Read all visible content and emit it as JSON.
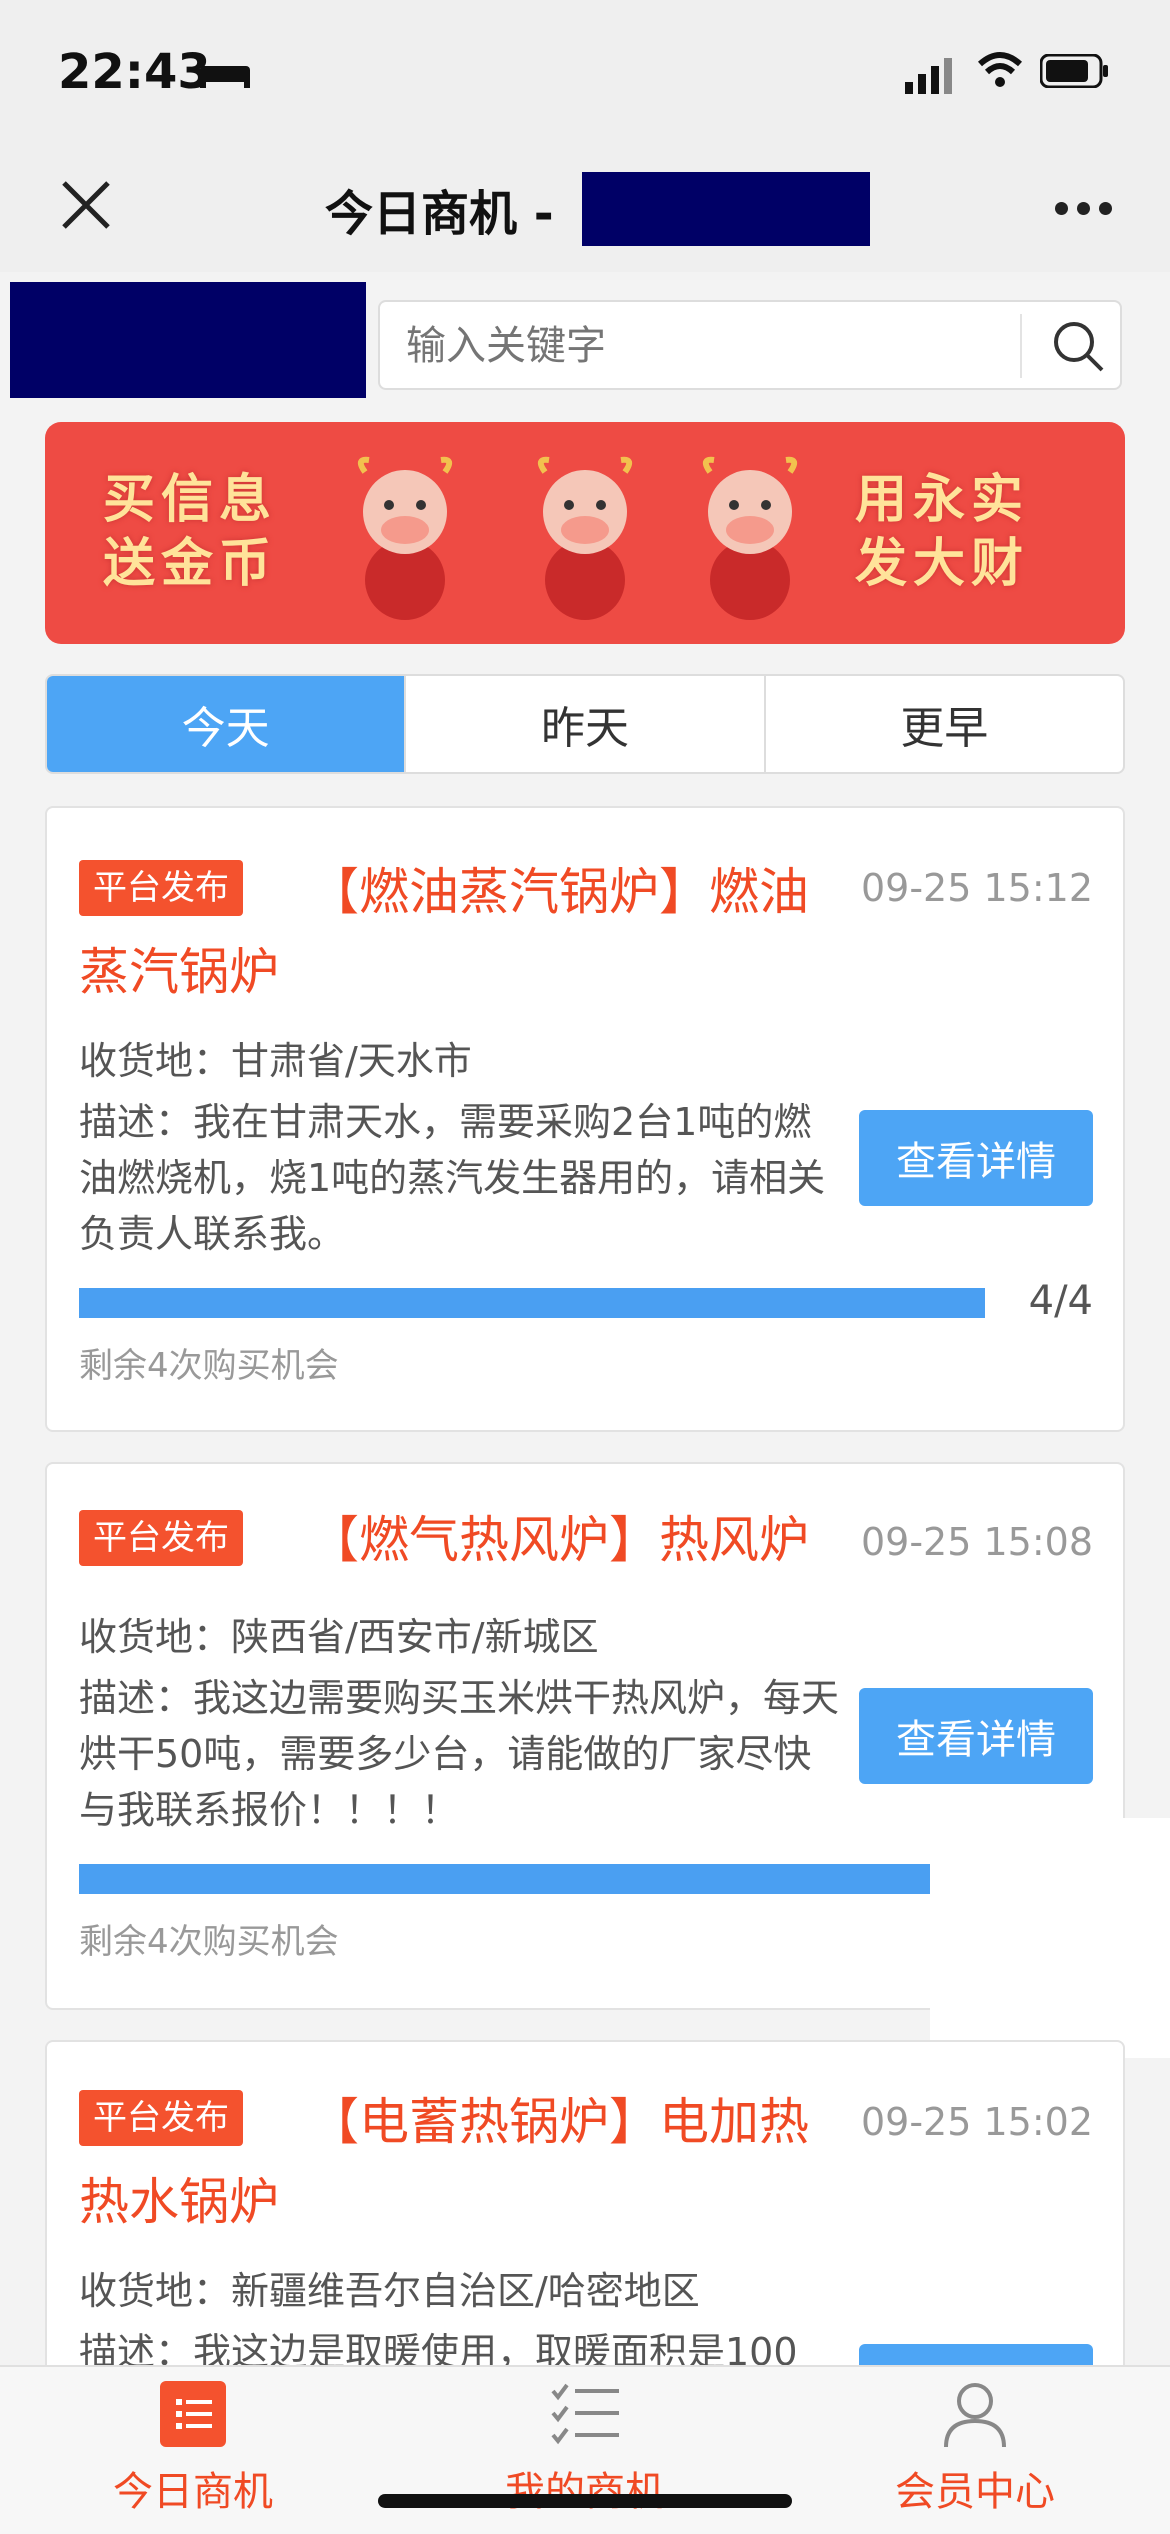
{
  "status_bar": {
    "time": "22:43"
  },
  "nav": {
    "title": "今日商机 -"
  },
  "search": {
    "placeholder": "输入关键字"
  },
  "banner": {
    "left_line1": "买信息",
    "left_line2": "送金币",
    "right_line1": "用永实",
    "right_line2": "发大财"
  },
  "tabs": [
    {
      "label": "今天",
      "active": true
    },
    {
      "label": "昨天",
      "active": false
    },
    {
      "label": "更早",
      "active": false
    }
  ],
  "listings": [
    {
      "badge": "平台发布",
      "title": "【燃油蒸汽锅炉】燃油蒸汽锅炉",
      "time": "09-25 15:12",
      "address": "收货地：甘肃省/天水市",
      "description": "描述：我在甘肃天水，需要采购2台1吨的燃油燃烧机，烧1吨的蒸汽发生器用的，请相关负责人联系我。",
      "button": "查看详情",
      "progress_count": "4/4",
      "progress_fraction": 1.0,
      "remaining": "剩余4次购买机会"
    },
    {
      "badge": "平台发布",
      "title": "【燃气热风炉】热风炉",
      "time": "09-25 15:08",
      "address": "收货地：陕西省/西安市/新城区",
      "description": "描述：我这边需要购买玉米烘干热风炉，每天烘干50吨，需要多少台，请能做的厂家尽快与我联系报价！！！！",
      "button": "查看详情",
      "progress_fraction": 1.0,
      "remaining": "剩余4次购买机会"
    },
    {
      "badge": "平台发布",
      "title": "【电蓄热锅炉】电加热热水锅炉",
      "time": "09-25 15:02",
      "address": "收货地：新疆维吾尔自治区/哈密地区",
      "description": "描述：我这边是取暖使用，取暖面积是100"
    }
  ],
  "tabbar": [
    {
      "label": "今日商机",
      "active": true,
      "icon": "list-icon"
    },
    {
      "label": "我的商机",
      "active": false,
      "icon": "checklist-icon"
    },
    {
      "label": "会员中心",
      "active": false,
      "icon": "user-icon"
    }
  ],
  "colors": {
    "accent_blue": "#4da5f5",
    "brand_red": "#f04a24",
    "banner_red": "#ee4b44"
  }
}
